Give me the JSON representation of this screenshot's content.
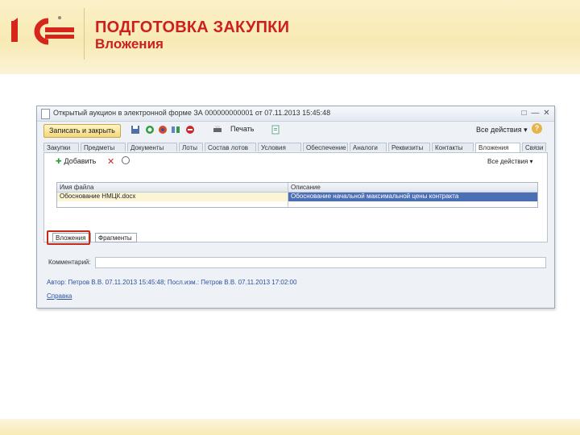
{
  "slide": {
    "title": "ПОДГОТОВКА ЗАКУПКИ",
    "subtitle": "Вложения",
    "logo_text": "1С"
  },
  "window": {
    "title": "Открытый аукцион в электронной форме ЗА 000000000001 от 07.11.2013 15:45:48",
    "controls": [
      "□",
      "—",
      "✕"
    ]
  },
  "toolbar": {
    "save_close_label": "Записать и закрыть",
    "print_label": "Печать",
    "all_actions_label": "Все действия ▾",
    "help_label": "?"
  },
  "tabs": [
    "Закупки",
    "Предметы",
    "Документы",
    "Лоты",
    "Состав лотов",
    "Условия",
    "Обеспечение",
    "Аналоги",
    "Реквизиты",
    "Контакты",
    "Вложения",
    "Связи"
  ],
  "attachments_panel": {
    "add_label": "Добавить",
    "all_actions_label": "Все действия ▾",
    "columns": [
      "Имя файла",
      "Описание"
    ],
    "rows": [
      {
        "file": "Обоснование НМЦК.docx",
        "description": "Обоснование начальной максимальной цены контракта"
      }
    ]
  },
  "bottom_tabs": [
    "Вложения",
    "Фрагменты"
  ],
  "comment_label": "Комментарий:",
  "author_line": "Автор: Петров В.В. 07.11.2013 15:45:48; Посл.изм.: Петров В.В. 07.11.2013 17:02:00",
  "help_link": "Справка",
  "colors": {
    "title_red": "#cc1f1f",
    "highlight": "#c62a1a",
    "selection_blue": "#4a6fb4",
    "link_blue": "#2b50a0"
  }
}
